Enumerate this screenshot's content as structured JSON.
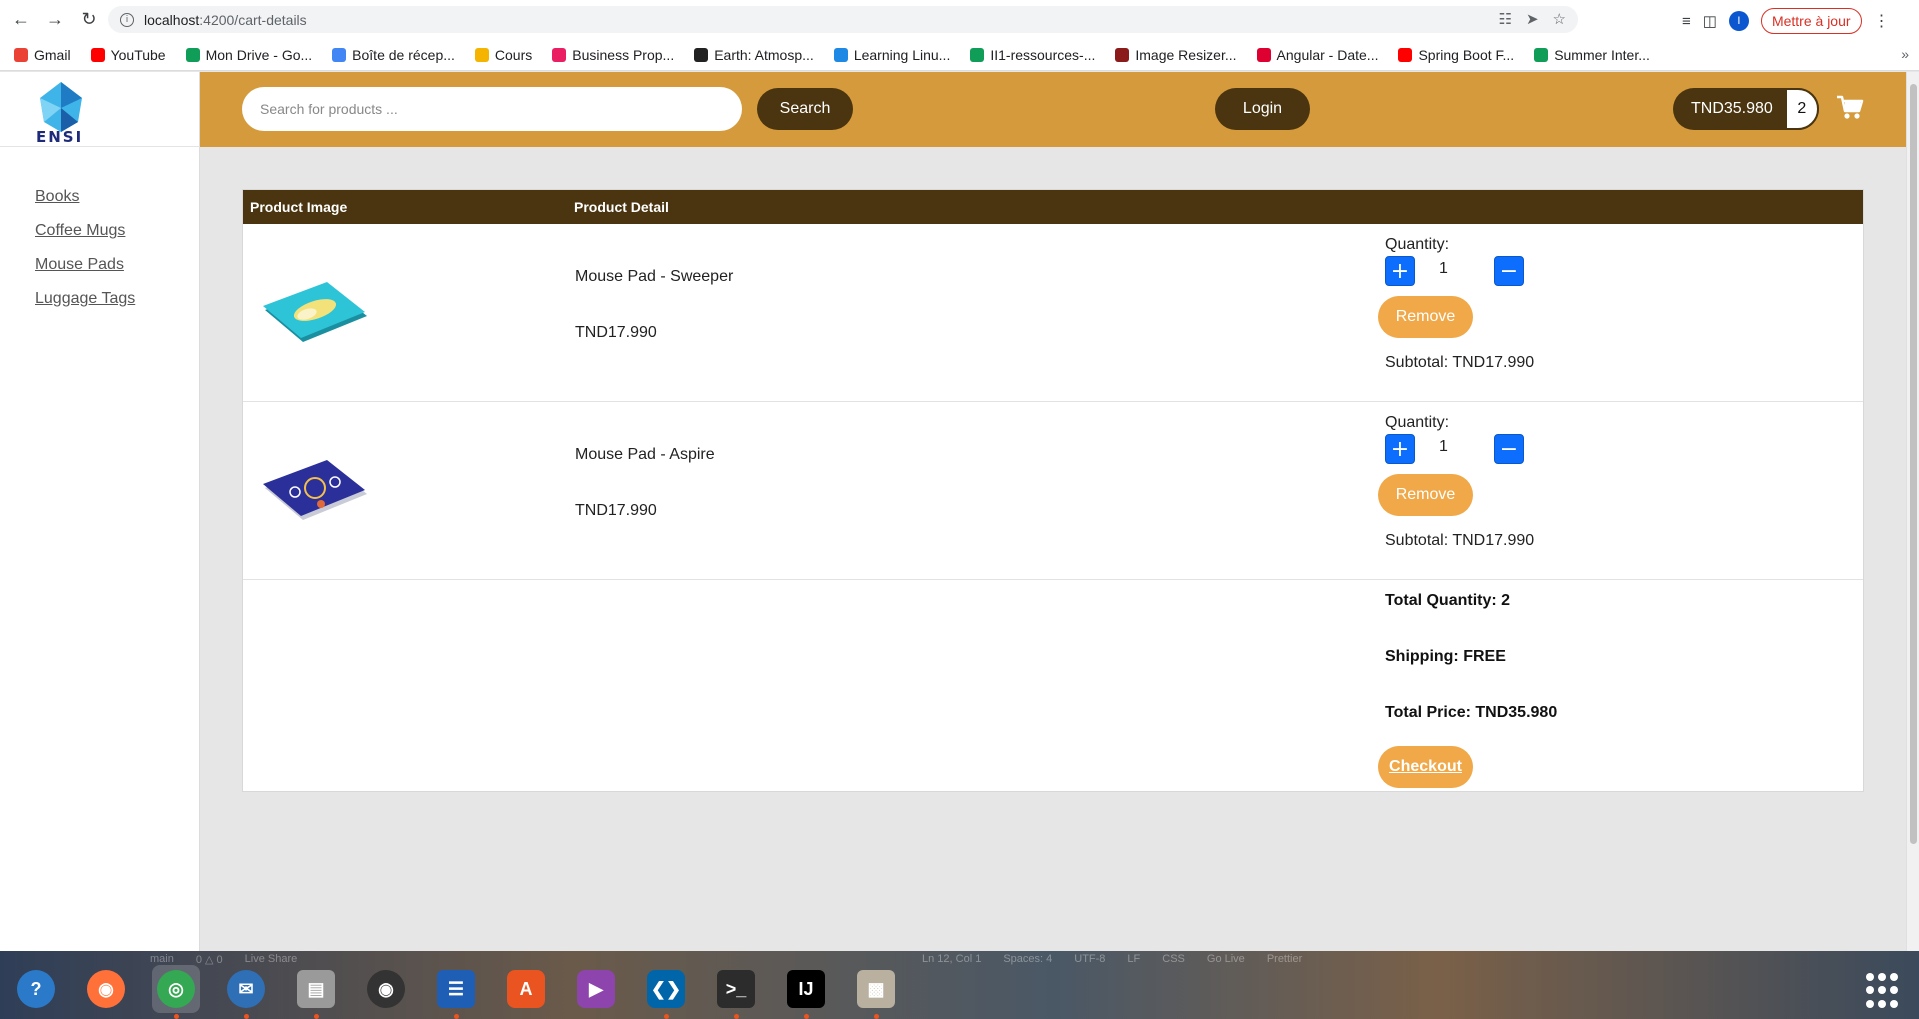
{
  "browser": {
    "url_host": "localhost",
    "url_path": ":4200/cart-details",
    "profile_initial": "I",
    "update_label": "Mettre à jour"
  },
  "bookmarks": [
    {
      "label": "Gmail",
      "color": "#ea4335"
    },
    {
      "label": "YouTube",
      "color": "#ff0000"
    },
    {
      "label": "Mon Drive - Go...",
      "color": "#0f9d58"
    },
    {
      "label": "Boîte de récep...",
      "color": "#4285f4"
    },
    {
      "label": "Cours",
      "color": "#f4b400"
    },
    {
      "label": "Business Prop...",
      "color": "#e91e63"
    },
    {
      "label": "Earth: Atmosp...",
      "color": "#222222"
    },
    {
      "label": "Learning Linu...",
      "color": "#1e88e5"
    },
    {
      "label": "II1-ressources-...",
      "color": "#0f9d58"
    },
    {
      "label": "Image Resizer...",
      "color": "#8b1a1a"
    },
    {
      "label": "Angular - Date...",
      "color": "#dd0031"
    },
    {
      "label": "Spring Boot F...",
      "color": "#ff0000"
    },
    {
      "label": "Summer Inter...",
      "color": "#0f9d58"
    }
  ],
  "logo": {
    "text": "ENSI"
  },
  "sidebar": {
    "categories": [
      "Books",
      "Coffee Mugs",
      "Mouse Pads",
      "Luggage Tags"
    ]
  },
  "header": {
    "search_placeholder": "Search for products ...",
    "search_label": "Search",
    "login_label": "Login",
    "cart_total": "TND35.980",
    "cart_count": "2"
  },
  "cart": {
    "col_image": "Product Image",
    "col_detail": "Product Detail",
    "quantity_label": "Quantity:",
    "remove_label": "Remove",
    "items": [
      {
        "name": "Mouse Pad - Sweeper",
        "price": "TND17.990",
        "quantity": "1",
        "subtotal": "Subtotal: TND17.990",
        "image_color": "#2ec4d8"
      },
      {
        "name": "Mouse Pad - Aspire",
        "price": "TND17.990",
        "quantity": "1",
        "subtotal": "Subtotal: TND17.990",
        "image_color": "#2b2f9a"
      }
    ],
    "total_quantity": "Total Quantity: 2",
    "shipping": "Shipping: FREE",
    "total_price": "Total Price: TND35.980",
    "checkout_label": "Checkout"
  },
  "colors": {
    "header_bg": "#d49a3c",
    "dark_brown": "#4a3510",
    "orange_button": "#f0a848",
    "blue_button": "#0d6efd"
  },
  "dock": {
    "status_left": [
      "main",
      "0 △ 0",
      "Live Share"
    ],
    "status_right": [
      "Ln 12, Col 1",
      "Spaces: 4",
      "UTF-8",
      "LF",
      "CSS",
      "Go Live",
      "Prettier"
    ],
    "apps": [
      "help-icon",
      "firefox-icon",
      "chrome-icon",
      "thunderbird-icon",
      "files-icon",
      "rhythmbox-icon",
      "writer-icon",
      "appstore-icon",
      "video-icon",
      "vscode-icon",
      "terminal-icon",
      "intellij-icon",
      "archive-icon"
    ]
  }
}
